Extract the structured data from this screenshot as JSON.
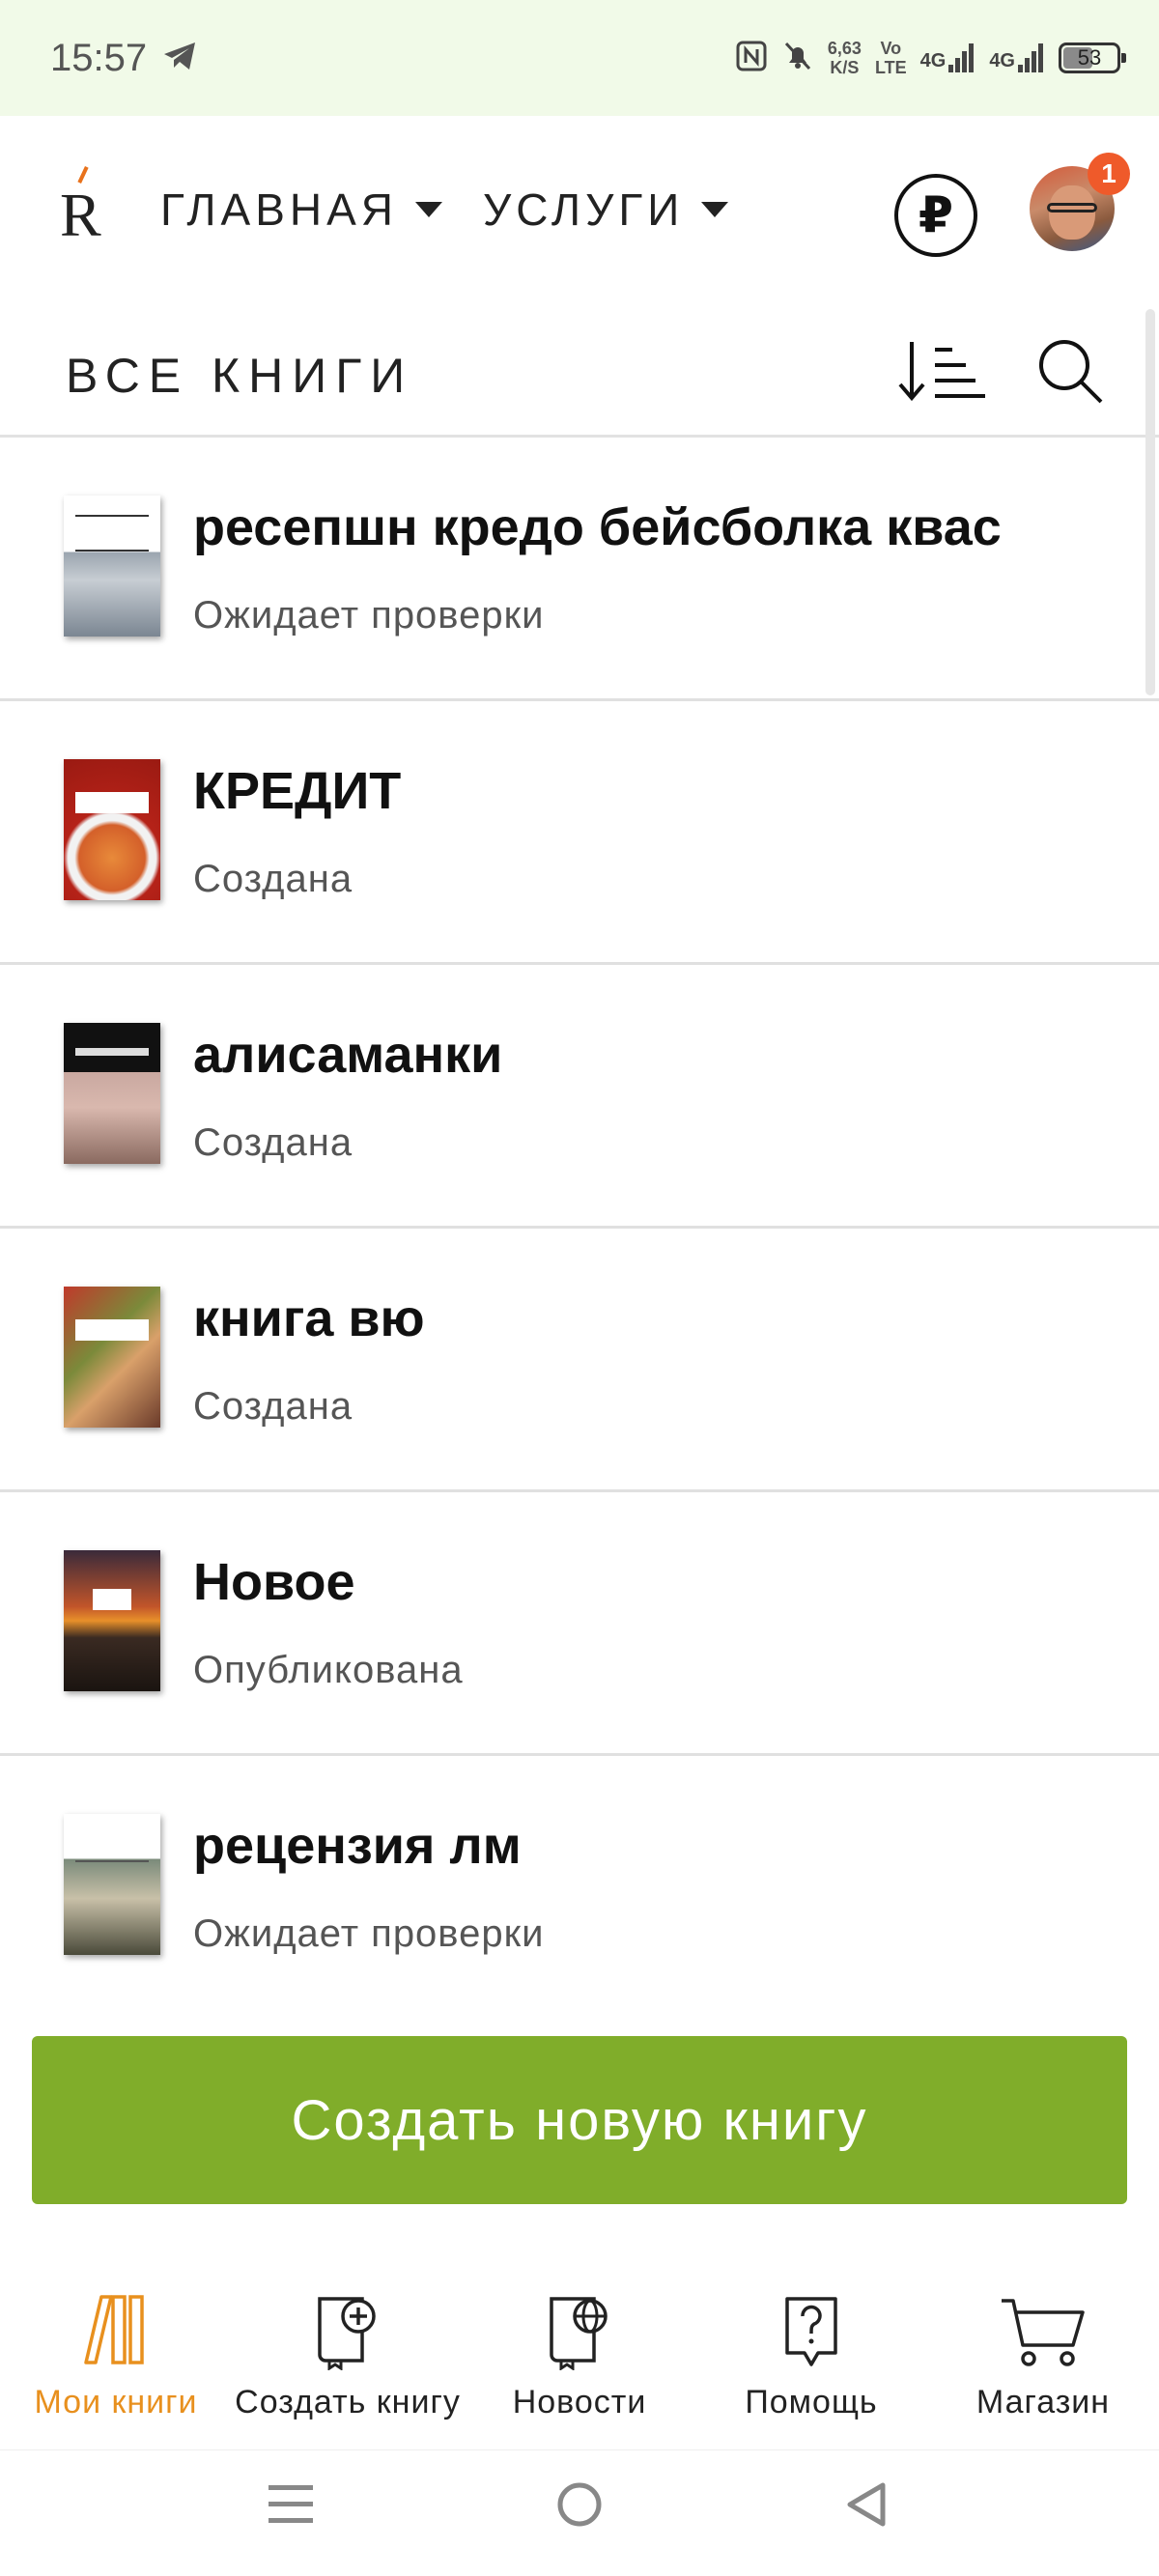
{
  "status_bar": {
    "time": "15:57",
    "net_speed_value": "6,63",
    "net_speed_unit": "K/S",
    "volte_top": "Vo",
    "volte_bottom": "LTE",
    "signal1": "4G",
    "signal2": "4G",
    "battery": "53"
  },
  "header": {
    "logo": "R",
    "nav": [
      {
        "label": "ГЛАВНАЯ"
      },
      {
        "label": "УСЛУГИ"
      }
    ],
    "currency_symbol": "₽",
    "notifications_count": "1"
  },
  "section": {
    "title": "ВСЕ КНИГИ"
  },
  "books": [
    {
      "title": "ресепшн кредо бейсболка квас",
      "status": "Ожидает проверки"
    },
    {
      "title": "КРЕДИТ",
      "status": "Создана"
    },
    {
      "title": "алисаманки",
      "status": "Создана"
    },
    {
      "title": "книга вю",
      "status": "Создана"
    },
    {
      "title": "Новое",
      "status": "Опубликована"
    },
    {
      "title": "рецензия лм",
      "status": "Ожидает проверки"
    }
  ],
  "actions": {
    "create_new_book": "Создать новую книгу"
  },
  "bottom_nav": [
    {
      "label": "Мои книги",
      "icon": "books-icon",
      "active": true
    },
    {
      "label": "Создать книгу",
      "icon": "book-plus-icon",
      "active": false
    },
    {
      "label": "Новости",
      "icon": "book-globe-icon",
      "active": false
    },
    {
      "label": "Помощь",
      "icon": "help-icon",
      "active": false
    },
    {
      "label": "Магазин",
      "icon": "cart-icon",
      "active": false
    }
  ],
  "colors": {
    "accent_green": "#80ad2a",
    "accent_orange": "#e8901e",
    "badge_red": "#ef5a2a",
    "status_bar_bg": "#f1fae8"
  }
}
